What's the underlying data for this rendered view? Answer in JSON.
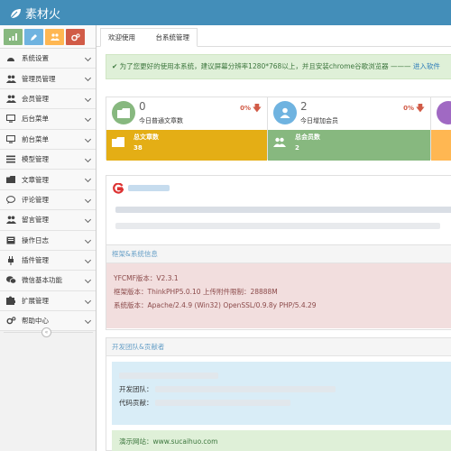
{
  "brand": {
    "title": "素材火"
  },
  "shortcuts": [
    {
      "icon": "chart-icon",
      "color": "#87b87f"
    },
    {
      "icon": "pencil-icon",
      "color": "#6fb3e0"
    },
    {
      "icon": "users-icon",
      "color": "#ffb752"
    },
    {
      "icon": "cogs-icon",
      "color": "#d15b47"
    }
  ],
  "sidebar": {
    "items": [
      {
        "label": "系统设置",
        "icon": "dashboard-icon"
      },
      {
        "label": "管理员管理",
        "icon": "users-icon"
      },
      {
        "label": "会员管理",
        "icon": "users-icon"
      },
      {
        "label": "后台菜单",
        "icon": "desktop-icon"
      },
      {
        "label": "前台菜单",
        "icon": "desktop-icon"
      },
      {
        "label": "模型管理",
        "icon": "list-icon"
      },
      {
        "label": "文章管理",
        "icon": "folder-icon"
      },
      {
        "label": "评论管理",
        "icon": "comment-icon"
      },
      {
        "label": "留言管理",
        "icon": "users-icon"
      },
      {
        "label": "操作日志",
        "icon": "book-icon"
      },
      {
        "label": "插件管理",
        "icon": "plug-icon"
      },
      {
        "label": "微信基本功能",
        "icon": "wechat-icon"
      },
      {
        "label": "扩展管理",
        "icon": "puzzle-icon"
      },
      {
        "label": "帮助中心",
        "icon": "cogs-icon"
      }
    ],
    "collapse_glyph": "«"
  },
  "tabbar": {
    "active_tab": "欢迎使用　　　台系统管理"
  },
  "notice": {
    "text": "为了您更好的使用本系统，建议屏幕分辨率1280*768以上，并且安装chrome谷歌浏览器 ———",
    "link": "进入软件"
  },
  "stats": [
    {
      "number": "0",
      "label": "今日普通文章数",
      "percent": "0%",
      "color_top": "#87b87f",
      "color_bottom": "#e4ae15",
      "bottom_title": "总文章数",
      "bottom_value": "38",
      "icon": "folder-icon"
    },
    {
      "number": "2",
      "label": "今日增加会员",
      "percent": "0%",
      "color_top": "#6fb3e0",
      "color_bottom": "#87b87f",
      "bottom_title": "总会员数",
      "bottom_value": "2",
      "icon": "user-icon"
    }
  ],
  "system_panel": {
    "title": "框架&系统信息",
    "lines": [
      "YFCMF版本：V2.3.1",
      "框架版本：ThinkPHP5.0.10  上传附件限制：28888M",
      "系统版本：Apache/2.4.9 (Win32) OpenSSL/0.9.8y PHP/5.4.29"
    ]
  },
  "team_panel": {
    "title": "开发团队&贡献者",
    "labels": [
      "开发团队：",
      "代码贡献："
    ]
  },
  "demo_panel": {
    "line1": "演示网站：www.sucaihuo.com"
  }
}
